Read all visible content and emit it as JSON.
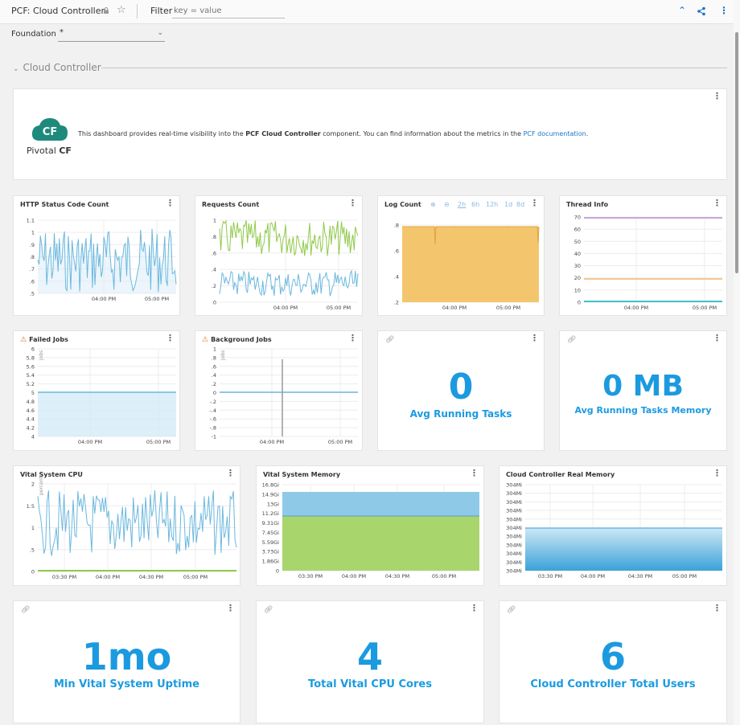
{
  "header": {
    "title": "PCF: Cloud Controller",
    "filter_label": "Filter",
    "filter_placeholder": "key = value"
  },
  "foundation": {
    "label": "Foundation",
    "value": "*"
  },
  "section": {
    "title": "Cloud Controller"
  },
  "info": {
    "logo_text": "CF",
    "brand": "Pivotal",
    "brand_bold": "CF",
    "text_before": "This dashboard provides real-time visibility into the ",
    "text_bold": "PCF Cloud Controller",
    "text_middle": " component. You can find information about the metrics in the ",
    "link": "PCF documentation",
    "text_end": "."
  },
  "time_controls": [
    "⊕",
    "⊖",
    "2h",
    "6h",
    "12h",
    "1d",
    "8d"
  ],
  "panels": {
    "http": {
      "title": "HTTP Status Code Count",
      "yticks": [
        "1.1",
        "1",
        ".9",
        ".8",
        ".7",
        ".6",
        ".5"
      ],
      "xticks": [
        "04:00 PM",
        "05:00 PM"
      ]
    },
    "requests": {
      "title": "Requests Count",
      "yticks": [
        "1",
        ".8",
        ".6",
        ".4",
        ".2",
        "0"
      ],
      "xticks": [
        "04:00 PM",
        "05:00 PM"
      ]
    },
    "log": {
      "title": "Log Count",
      "yticks": [
        ".8",
        ".6",
        ".4",
        ".2"
      ],
      "xticks": [
        "04:00 PM",
        "05:00 PM"
      ]
    },
    "thread": {
      "title": "Thread Info",
      "yticks": [
        "70",
        "60",
        "50",
        "40",
        "30",
        "20",
        "10",
        "0"
      ],
      "xticks": [
        "04:00 PM",
        "05:00 PM"
      ]
    },
    "failed": {
      "title": "Failed Jobs",
      "unit": "jobs",
      "yticks": [
        "6",
        "5.8",
        "5.6",
        "5.4",
        "5.2",
        "5",
        "4.8",
        "4.6",
        "4.4",
        "4.2",
        "4"
      ],
      "xticks": [
        "04:00 PM",
        "05:00 PM"
      ]
    },
    "background": {
      "title": "Background Jobs",
      "unit": "jobs",
      "yticks": [
        "1",
        ".8",
        ".6",
        ".4",
        ".2",
        "0",
        "-.2",
        "-.4",
        "-.6",
        "-.8",
        "-1"
      ],
      "xticks": [
        "04:00 PM",
        "05:00 PM"
      ]
    },
    "avg_tasks": {
      "value": "0",
      "label": "Avg Running Tasks"
    },
    "avg_memory": {
      "value": "0 MB",
      "label": "Avg Running Tasks Memory"
    },
    "cpu": {
      "title": "Vital System CPU",
      "unit": "percent",
      "yticks": [
        "2",
        "1.5",
        "1",
        ".5",
        "0"
      ],
      "xticks": [
        "03:30 PM",
        "04:00 PM",
        "04:30 PM",
        "05:00 PM"
      ]
    },
    "memory": {
      "title": "Vital System Memory",
      "yticks": [
        "16.8Gi",
        "14.9Gi",
        "13Gi",
        "11.2Gi",
        "9.31Gi",
        "7.45Gi",
        "5.59Gi",
        "3.73Gi",
        "1.86Gi",
        "0"
      ],
      "xticks": [
        "03:30 PM",
        "04:00 PM",
        "04:30 PM",
        "05:00 PM"
      ]
    },
    "realmem": {
      "title": "Cloud Controller Real Memory",
      "yticks": [
        "304Mi",
        "304Mi",
        "304Mi",
        "304Mi",
        "304Mi",
        "304Mi",
        "304Mi",
        "304Mi",
        "304Mi",
        "304Mi",
        "304Mi"
      ],
      "xticks": [
        "03:30 PM",
        "04:00 PM",
        "04:30 PM",
        "05:00 PM"
      ]
    },
    "uptime": {
      "value": "1mo",
      "label": "Min Vital System Uptime"
    },
    "cores": {
      "value": "4",
      "label": "Total Vital CPU Cores"
    },
    "users": {
      "value": "6",
      "label": "Cloud Controller Total Users"
    }
  },
  "colors": {
    "accent": "#1b9ae0",
    "blue_line": "#6cb8de",
    "green_line": "#8fc94a",
    "log_fill": "#f3c66e",
    "mem_blue": "#8ecae8",
    "mem_green": "#a9d56d",
    "purple": "#c7a6e0",
    "orange": "#f5c58e",
    "teal": "#3fc2c9"
  }
}
